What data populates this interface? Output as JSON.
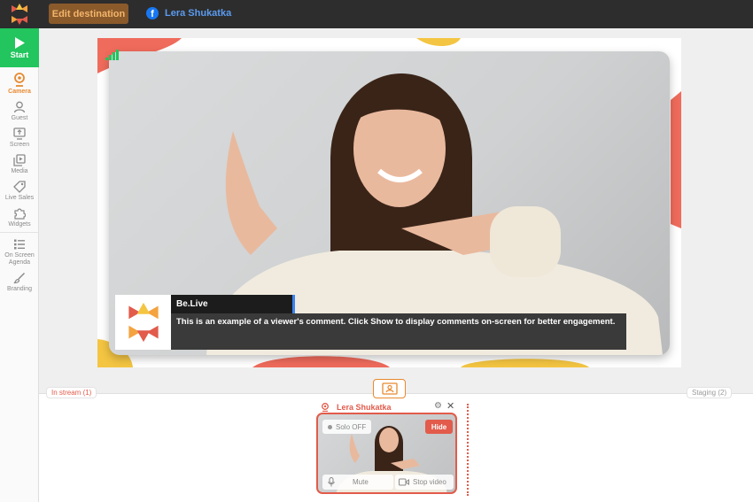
{
  "topbar": {
    "edit_button": "Edit destination",
    "destination_name": "Lera Shukatka"
  },
  "sidebar": {
    "start_label": "Start",
    "items": [
      {
        "label": "Camera",
        "icon": "camera-icon"
      },
      {
        "label": "Guest",
        "icon": "guest-icon"
      },
      {
        "label": "Screen",
        "icon": "screen-icon"
      },
      {
        "label": "Media",
        "icon": "media-icon"
      },
      {
        "label": "Live Sales",
        "icon": "tag-icon"
      },
      {
        "label": "Widgets",
        "icon": "puzzle-icon"
      },
      {
        "label": "On Screen Agenda",
        "icon": "list-icon"
      },
      {
        "label": "Branding",
        "icon": "brush-icon"
      }
    ]
  },
  "comment": {
    "author": "Be.Live",
    "text": "This is an example of a viewer's comment. Click Show to display comments on-screen for better engagement."
  },
  "bottom": {
    "in_stream_tab": "In stream (1)",
    "staging_tab": "Staging (2)"
  },
  "guest_card": {
    "name": "Lera Shukatka",
    "solo_label": "Solo OFF",
    "hide_label": "Hide",
    "mute_label": "Mute",
    "stop_video_label": "Stop video"
  },
  "colors": {
    "brand_orange": "#e8892f",
    "live_red": "#e25b4b",
    "start_green": "#22c55e",
    "facebook_blue": "#1877f2"
  }
}
